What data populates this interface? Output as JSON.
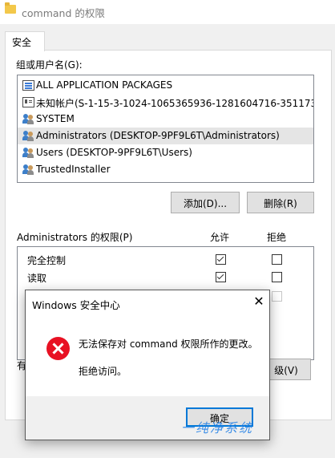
{
  "window": {
    "title": "command 的权限"
  },
  "tabs": [
    {
      "label": "安全"
    }
  ],
  "group_label": "组或用户名(G):",
  "users": [
    {
      "name": "ALL APPLICATION PACKAGES",
      "icon": "package-icon"
    },
    {
      "name": "未知帐户(S-1-15-3-1024-1065365936-1281604716-351173...",
      "icon": "account-card-icon"
    },
    {
      "name": "SYSTEM",
      "icon": "users-icon"
    },
    {
      "name": "Administrators (DESKTOP-9PF9L6T\\Administrators)",
      "icon": "users-icon",
      "selected": true
    },
    {
      "name": "Users (DESKTOP-9PF9L6T\\Users)",
      "icon": "users-icon"
    },
    {
      "name": "TrustedInstaller",
      "icon": "users-icon"
    }
  ],
  "buttons": {
    "add": "添加(D)...",
    "remove": "删除(R)"
  },
  "permissions": {
    "header": "Administrators 的权限(P)",
    "allow_col": "允许",
    "deny_col": "拒绝",
    "rows": [
      {
        "label": "完全控制",
        "allow": true,
        "deny": false
      },
      {
        "label": "读取",
        "allow": true,
        "deny": false
      }
    ]
  },
  "hidden_left_text": "有",
  "right_button_partial": "级(V)",
  "dialog": {
    "title": "Windows 安全中心",
    "message": "无法保存对 command 权限所作的更改。",
    "detail": "拒绝访问。",
    "ok_label": "确定"
  },
  "watermark": "一纯净系统",
  "colors": {
    "accent": "#0078d7",
    "error": "#e81123",
    "selection": "#e5e5e5"
  }
}
